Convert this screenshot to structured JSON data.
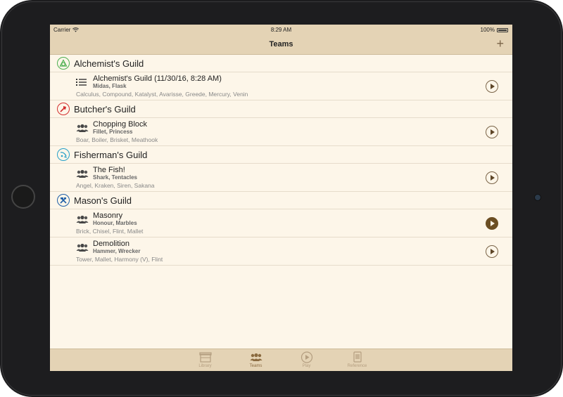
{
  "status": {
    "carrier": "Carrier",
    "time": "8:29 AM",
    "battery": "100%"
  },
  "nav": {
    "title": "Teams",
    "add_label": "+"
  },
  "sections": [
    {
      "title": "Alchemist's Guild",
      "icon": "alchemist-guild-icon",
      "color": "#4caf50",
      "rows": [
        {
          "name": "Alchemist's Guild (11/30/16, 8:28 AM)",
          "sub": "Midas, Flask",
          "members": "Calculus, Compound, Katalyst, Avarisse, Greede, Mercury, Venin",
          "icon": "list-icon",
          "active": false
        }
      ]
    },
    {
      "title": "Butcher's Guild",
      "icon": "butcher-guild-icon",
      "color": "#d32f2f",
      "rows": [
        {
          "name": "Chopping Block",
          "sub": "Fillet, Princess",
          "members": "Boar, Boiler, Brisket, Meathook",
          "icon": "team-icon",
          "active": false
        }
      ]
    },
    {
      "title": "Fisherman's Guild",
      "icon": "fisherman-guild-icon",
      "color": "#26a0c8",
      "rows": [
        {
          "name": "The Fish!",
          "sub": "Shark, Tentacles",
          "members": "Angel, Kraken, Siren, Sakana",
          "icon": "team-icon",
          "active": false
        }
      ]
    },
    {
      "title": "Mason's Guild",
      "icon": "mason-guild-icon",
      "color": "#1f5fa8",
      "rows": [
        {
          "name": "Masonry",
          "sub": "Honour, Marbles",
          "members": "Brick, Chisel, Flint, Mallet",
          "icon": "team-icon",
          "active": true
        },
        {
          "name": "Demolition",
          "sub": "Hammer, Wrecker",
          "members": "Tower, Mallet, Harmony (V), Flint",
          "icon": "team-icon",
          "active": false
        }
      ]
    }
  ],
  "tabs": [
    {
      "label": "Library",
      "icon": "library-icon",
      "selected": false
    },
    {
      "label": "Teams",
      "icon": "teams-icon",
      "selected": true
    },
    {
      "label": "Play",
      "icon": "play-icon",
      "selected": false
    },
    {
      "label": "Reference",
      "icon": "reference-icon",
      "selected": false
    }
  ]
}
